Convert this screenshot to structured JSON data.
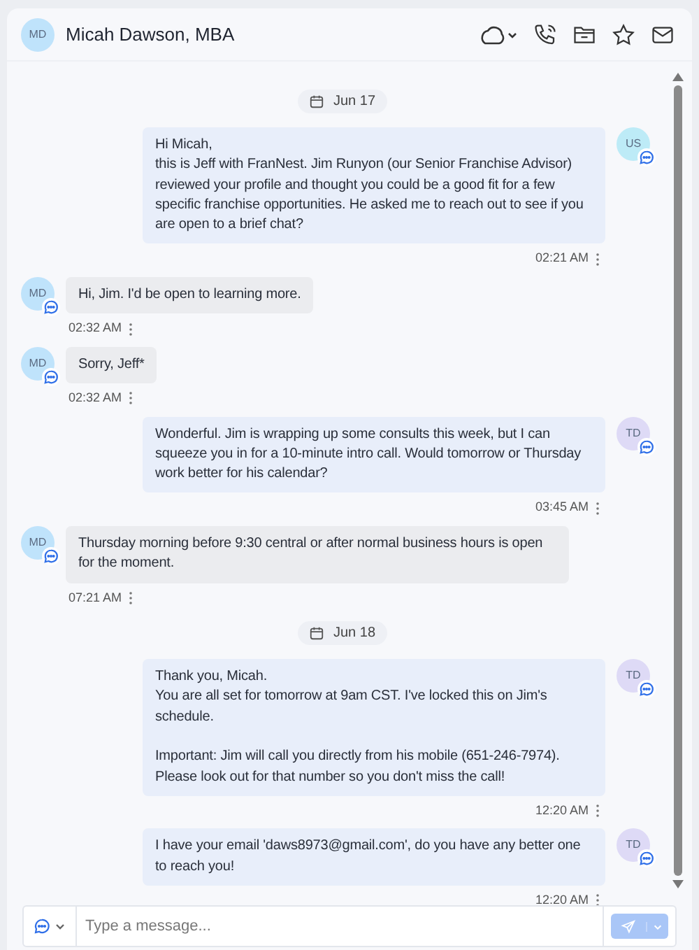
{
  "header": {
    "avatar": {
      "initials": "MD",
      "color": "#bfe3fb"
    },
    "title": "Micah Dawson, MBA"
  },
  "items": [
    {
      "kind": "date",
      "label": "Jun 17"
    },
    {
      "kind": "out",
      "avatar": {
        "initials": "US",
        "color": "#bdebf7"
      },
      "text": "Hi Micah,\nthis is Jeff with FranNest. Jim Runyon (our Senior Franchise Advisor) reviewed your profile and thought you could be a good fit for a few specific franchise opportunities. He asked me to reach out to see if you are open to a brief chat?",
      "time": "02:21 AM"
    },
    {
      "kind": "in",
      "avatar": {
        "initials": "MD",
        "color": "#bfe3fb"
      },
      "text": "Hi, Jim. I'd be open to learning more.",
      "time": "02:32 AM"
    },
    {
      "kind": "in",
      "avatar": {
        "initials": "MD",
        "color": "#bfe3fb"
      },
      "text": "Sorry, Jeff*",
      "time": "02:32 AM"
    },
    {
      "kind": "out",
      "avatar": {
        "initials": "TD",
        "color": "#dedaf6"
      },
      "text": "Wonderful. Jim is wrapping up some consults this week, but I can squeeze you in for a 10-minute intro call. Would tomorrow or Thursday work better for his calendar?",
      "time": "03:45 AM"
    },
    {
      "kind": "in",
      "avatar": {
        "initials": "MD",
        "color": "#bfe3fb"
      },
      "text": "Thursday morning before 9:30 central or after normal business hours is open for the moment.",
      "time": "07:21 AM"
    },
    {
      "kind": "date",
      "label": "Jun 18"
    },
    {
      "kind": "out",
      "avatar": {
        "initials": "TD",
        "color": "#dedaf6"
      },
      "text": "Thank you, Micah.\nYou are all set for tomorrow at 9am CST. I've locked this on Jim's schedule.\n\nImportant: Jim will call you directly from his mobile (651-246-7974). Please look out for that number so you don't miss the call!",
      "time": "12:20 AM"
    },
    {
      "kind": "out",
      "avatar": {
        "initials": "TD",
        "color": "#dedaf6"
      },
      "text": "I have your email 'daws8973@gmail.com', do you have any better one to reach you!",
      "time": "12:20 AM"
    }
  ],
  "composer": {
    "placeholder": "Type a message..."
  }
}
